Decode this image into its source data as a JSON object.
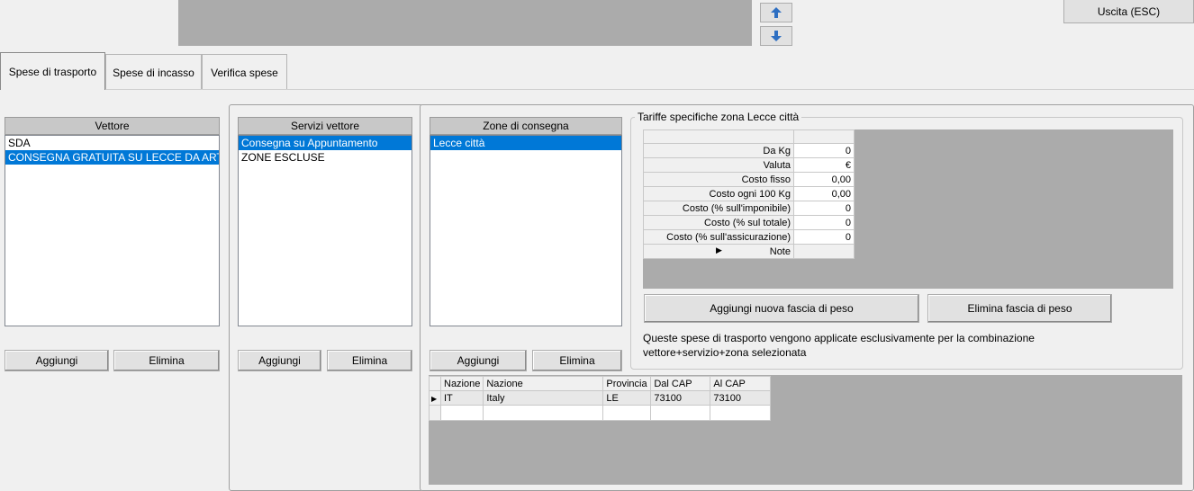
{
  "topbar": {
    "up_icon": "arrow-up-icon",
    "down_icon": "arrow-down-icon",
    "exit_label": "Uscita (ESC)"
  },
  "tabs": [
    {
      "label": "Spese di trasporto",
      "active": true
    },
    {
      "label": "Spese di incasso",
      "active": false
    },
    {
      "label": "Verifica spese",
      "active": false
    }
  ],
  "vettore": {
    "header": "Vettore",
    "items": [
      "SDA",
      "CONSEGNA GRATUITA SU LECCE DA ART"
    ],
    "selected_index": 1,
    "add_label": "Aggiungi",
    "delete_label": "Elimina"
  },
  "servizi": {
    "header": "Servizi vettore",
    "items": [
      "Consegna su Appuntamento",
      "ZONE ESCLUSE"
    ],
    "selected_index": 0,
    "add_label": "Aggiungi",
    "delete_label": "Elimina"
  },
  "zone": {
    "header": "Zone di consegna",
    "items": [
      "Lecce città"
    ],
    "selected_index": 0,
    "add_label": "Aggiungi",
    "delete_label": "Elimina"
  },
  "tariffe": {
    "legend": "Tariffe specifiche zona Lecce città",
    "rows": [
      {
        "label": "Da Kg",
        "value": "0"
      },
      {
        "label": "Valuta",
        "value": "€"
      },
      {
        "label": "Costo fisso",
        "value": "0,00"
      },
      {
        "label": "Costo ogni 100 Kg",
        "value": "0,00"
      },
      {
        "label": "Costo (% sull'imponibile)",
        "value": "0"
      },
      {
        "label": "Costo (% sul totale)",
        "value": "0"
      },
      {
        "label": "Costo (% sull'assicurazione)",
        "value": "0"
      },
      {
        "label": "Note",
        "value": ""
      }
    ],
    "add_band_label": "Aggiungi nuova fascia di peso",
    "delete_band_label": "Elimina fascia di peso",
    "info_text_line1": "Queste spese di trasporto vengono applicate esclusivamente per la combinazione",
    "info_text_line2": "vettore+servizio+zona selezionata"
  },
  "zone_table": {
    "columns": [
      "Nazione",
      "Nazione",
      "Provincia",
      "Dal CAP",
      "Al CAP"
    ],
    "rows": [
      [
        "IT",
        "Italy",
        "LE",
        "73100",
        "73100"
      ],
      [
        "",
        "",
        "",
        "",
        ""
      ]
    ]
  }
}
